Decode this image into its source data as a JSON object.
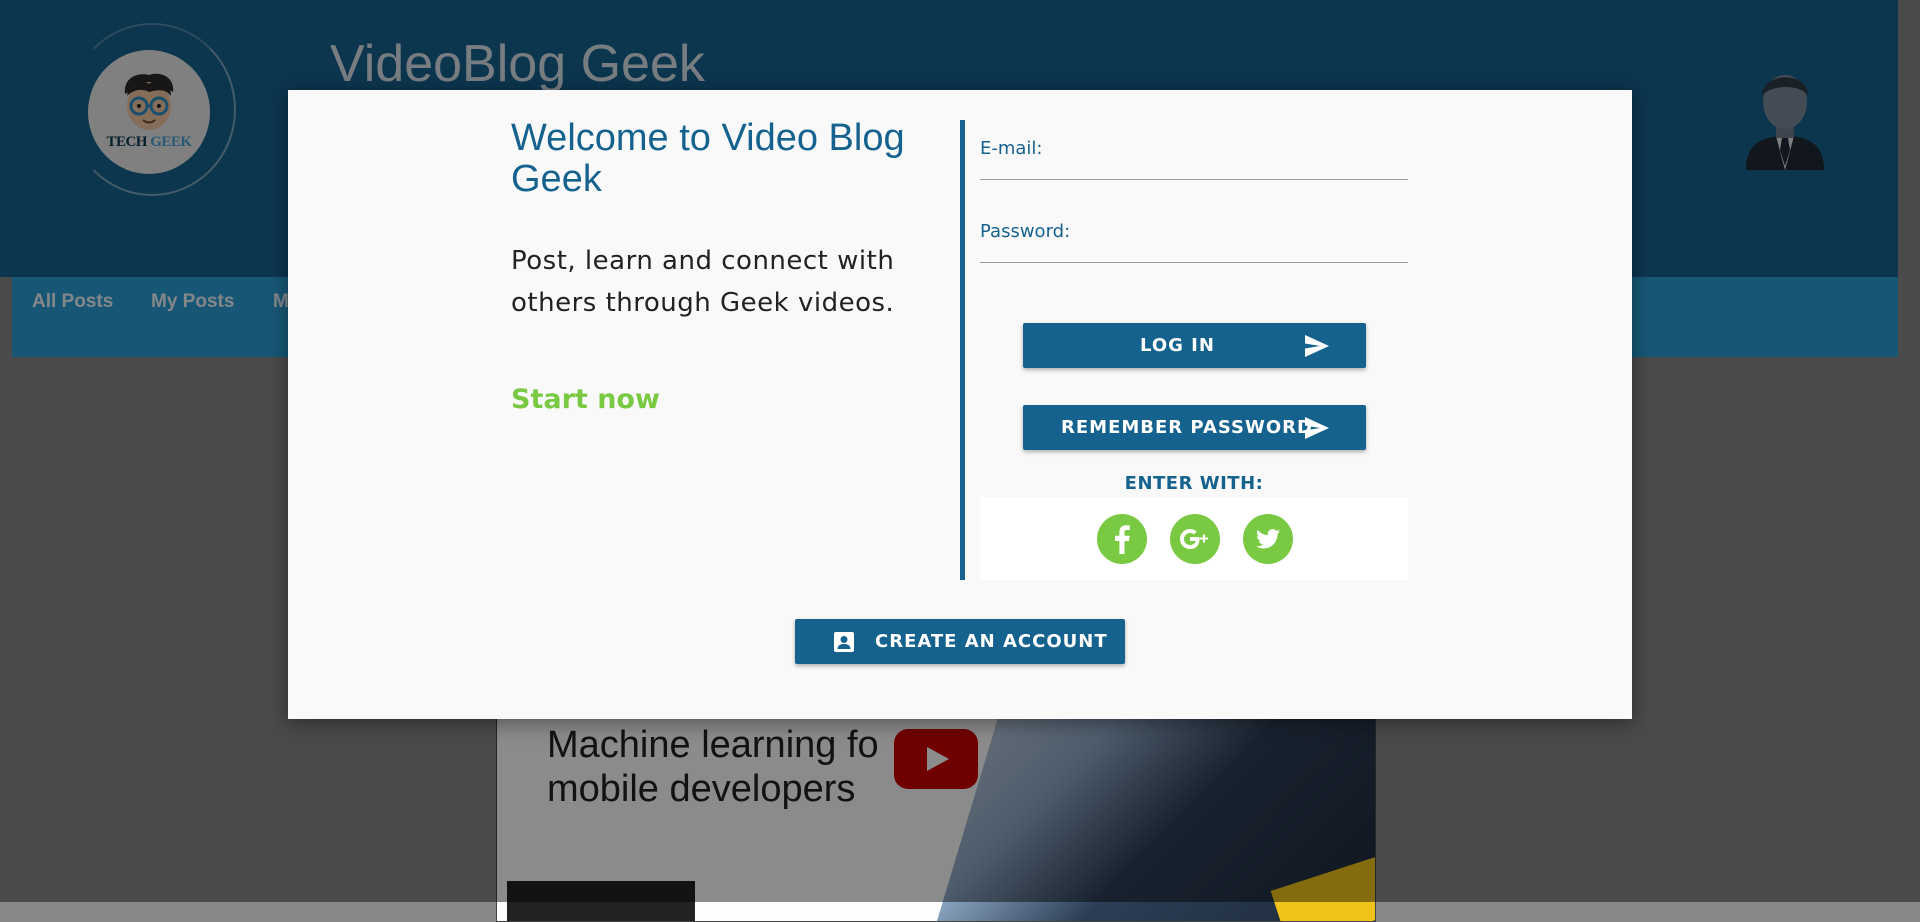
{
  "header": {
    "site_title": "VideoBlog Geek",
    "logo_text_dark": "TECH ",
    "logo_text_accent": "GEEK"
  },
  "nav": {
    "items": [
      {
        "label": "All Posts"
      },
      {
        "label": "My Posts"
      },
      {
        "label": "M"
      }
    ]
  },
  "video": {
    "line1": "Machine learning fo",
    "line2": "mobile developers"
  },
  "modal": {
    "title": "Welcome to Video Blog Geek",
    "description": "Post, learn and connect with others through Geek videos.",
    "start_now": "Start now",
    "email_label": "E-mail:",
    "email_value": "",
    "password_label": "Password:",
    "password_value": "",
    "login_label": "LOG IN",
    "remember_label": "REMEMBER PASSWORD",
    "enter_with_label": "ENTER WITH:",
    "social": [
      {
        "icon": "facebook-icon"
      },
      {
        "icon": "google-plus-icon"
      },
      {
        "icon": "twitter-icon"
      }
    ],
    "create_account_label": "CREATE AN ACCOUNT"
  },
  "colors": {
    "primary": "#16628f",
    "navbar": "#2a9fd6",
    "accent_green": "#7ac943",
    "modal_bg": "#f9f9f9"
  }
}
